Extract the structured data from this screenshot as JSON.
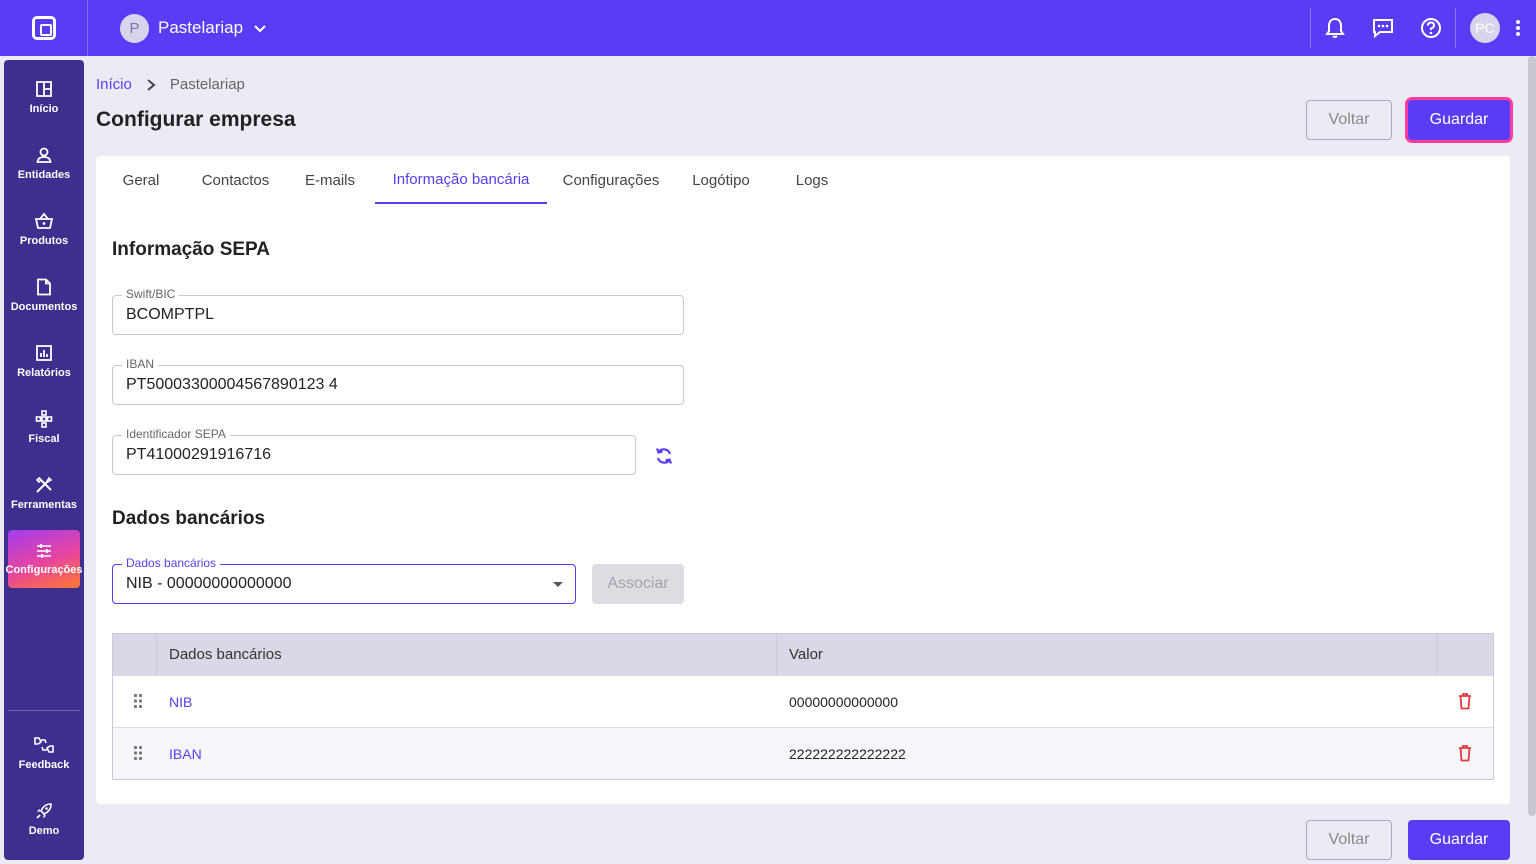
{
  "topbar": {
    "company_initial": "P",
    "company_name": "Pastelariap",
    "user_initials": "PC",
    "icons": [
      "bell-icon",
      "chat-icon",
      "help-icon",
      "more-vert-icon"
    ]
  },
  "sidebar": {
    "items": [
      {
        "label": "Início",
        "icon": "dashboard-icon"
      },
      {
        "label": "Entidades",
        "icon": "person-icon"
      },
      {
        "label": "Produtos",
        "icon": "basket-icon"
      },
      {
        "label": "Documentos",
        "icon": "document-icon"
      },
      {
        "label": "Relatórios",
        "icon": "chart-icon"
      },
      {
        "label": "Fiscal",
        "icon": "fiscal-icon"
      },
      {
        "label": "Ferramentas",
        "icon": "tools-icon"
      },
      {
        "label": "Configurações",
        "icon": "sliders-icon"
      }
    ],
    "bottom": [
      {
        "label": "Feedback",
        "icon": "feedback-icon"
      },
      {
        "label": "Demo",
        "icon": "rocket-icon"
      }
    ],
    "active": "Configurações"
  },
  "breadcrumb": {
    "home": "Início",
    "current": "Pastelariap"
  },
  "page": {
    "title": "Configurar empresa"
  },
  "actions": {
    "back": "Voltar",
    "save": "Guardar"
  },
  "tabs": [
    "Geral",
    "Contactos",
    "E-mails",
    "Informação bancária",
    "Configurações",
    "Logótipo",
    "Logs"
  ],
  "active_tab": "Informação bancária",
  "sepa": {
    "title": "Informação SEPA",
    "swift_label": "Swift/BIC",
    "swift_value": "BCOMPTPL",
    "iban_label": "IBAN",
    "iban_value": "PT50003300004567890123 4",
    "sepa_id_label": "Identificador SEPA",
    "sepa_id_value": "PT41000291916716"
  },
  "bank": {
    "title": "Dados bancários",
    "select_label": "Dados bancários",
    "select_value": "NIB - 00000000000000",
    "associate_label": "Associar",
    "table": {
      "headers": [
        "Dados bancários",
        "Valor"
      ],
      "rows": [
        {
          "key": "NIB",
          "value": "00000000000000"
        },
        {
          "key": "IBAN",
          "value": "222222222222222"
        }
      ]
    }
  },
  "colors": {
    "accent": "#5b3cf5",
    "sidebar": "#3c2f8e",
    "danger": "#e23b3b"
  }
}
